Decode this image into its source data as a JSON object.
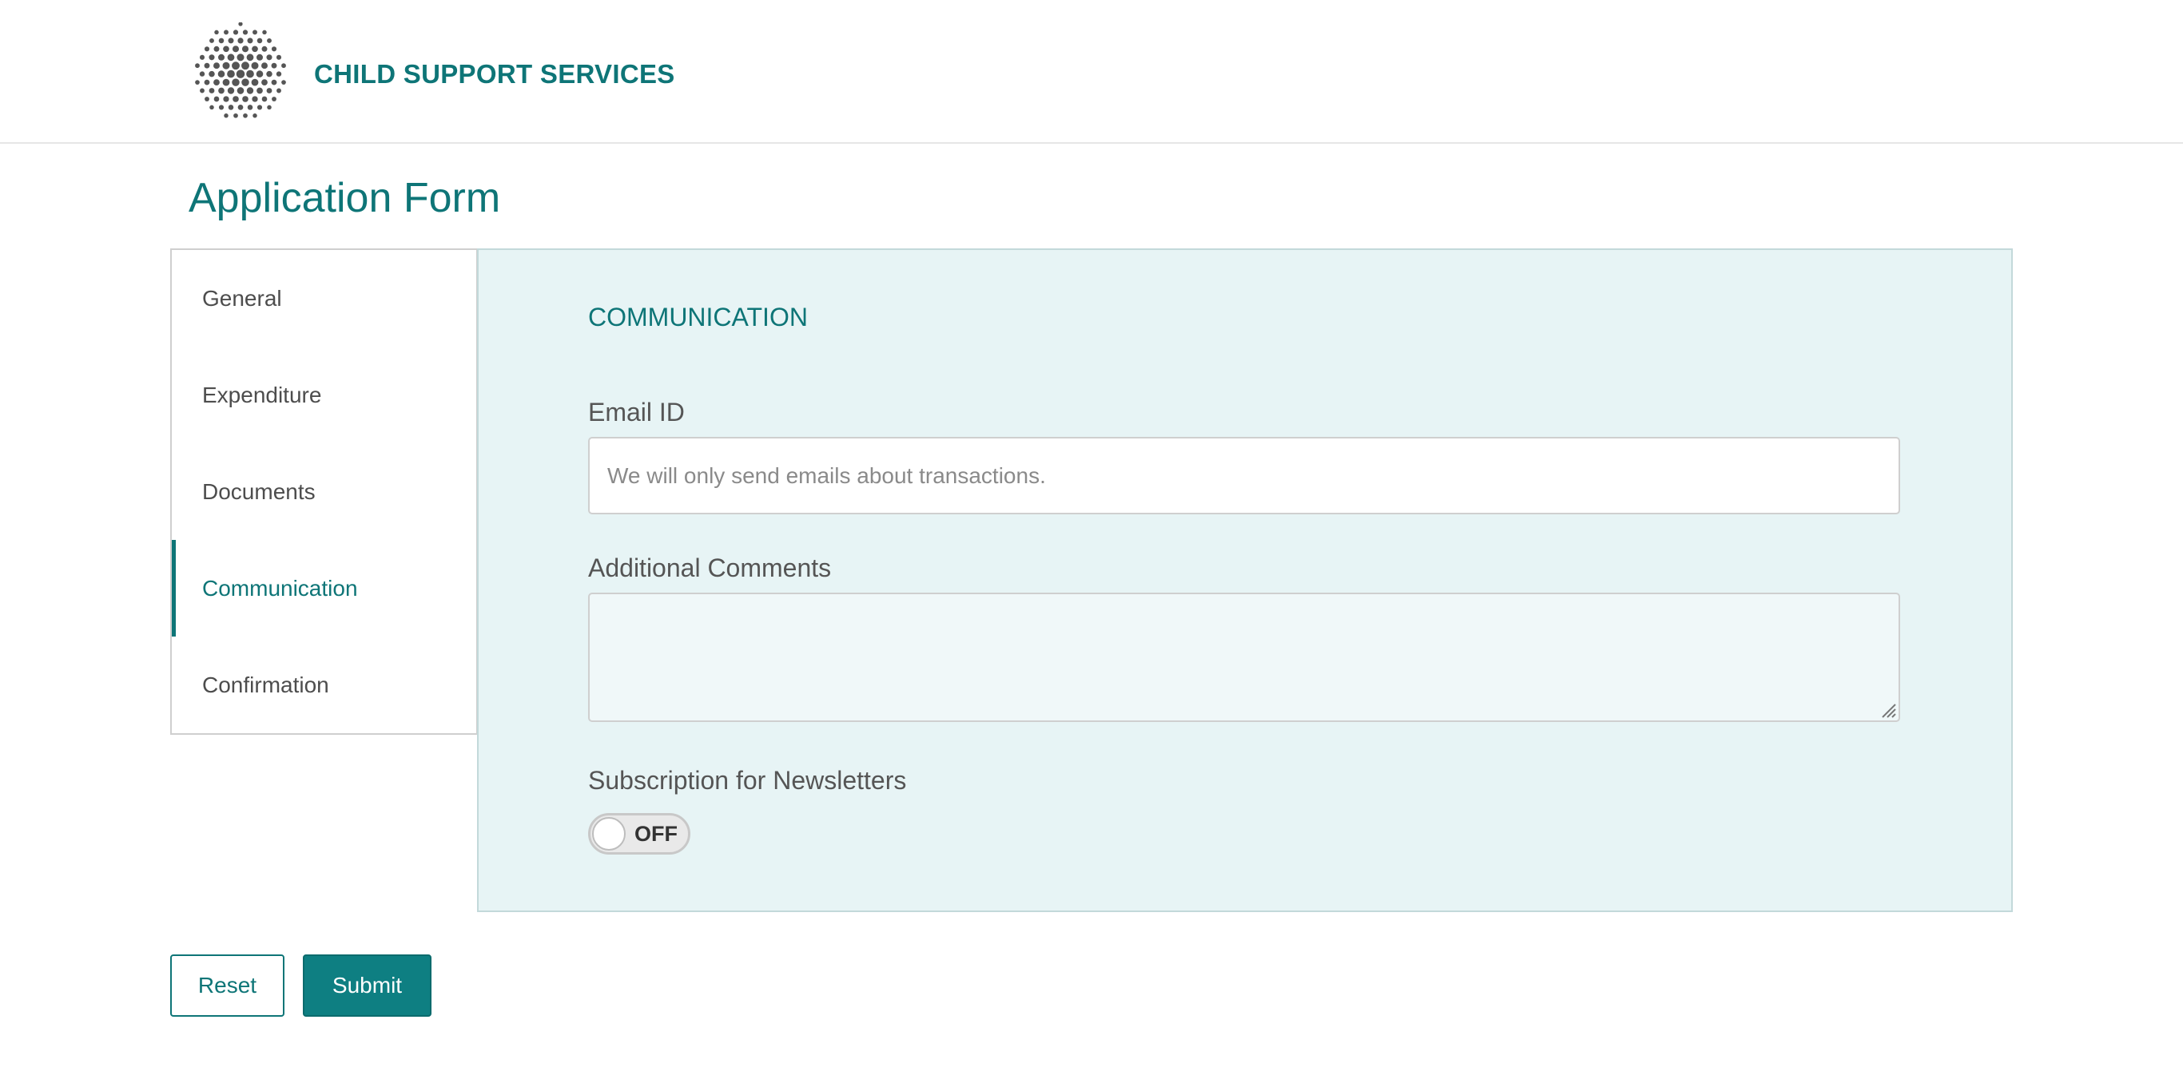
{
  "header": {
    "brand": "CHILD SUPPORT SERVICES",
    "logo_icon": "dotted-sphere-logo-icon"
  },
  "page": {
    "title": "Application Form"
  },
  "nav": {
    "items": [
      {
        "label": "General",
        "active": false
      },
      {
        "label": "Expenditure",
        "active": false
      },
      {
        "label": "Documents",
        "active": false
      },
      {
        "label": "Communication",
        "active": true
      },
      {
        "label": "Confirmation",
        "active": false
      }
    ]
  },
  "form": {
    "section_title": "COMMUNICATION",
    "email": {
      "label": "Email ID",
      "value": "",
      "placeholder": "We will only send emails about transactions."
    },
    "comments": {
      "label": "Additional Comments",
      "value": ""
    },
    "newsletter": {
      "label": "Subscription for Newsletters",
      "state": "OFF"
    }
  },
  "actions": {
    "reset_label": "Reset",
    "submit_label": "Submit"
  },
  "colors": {
    "accent": "#0e7577",
    "panel_bg": "#e7f4f5",
    "submit_bg": "#0e7f82"
  }
}
